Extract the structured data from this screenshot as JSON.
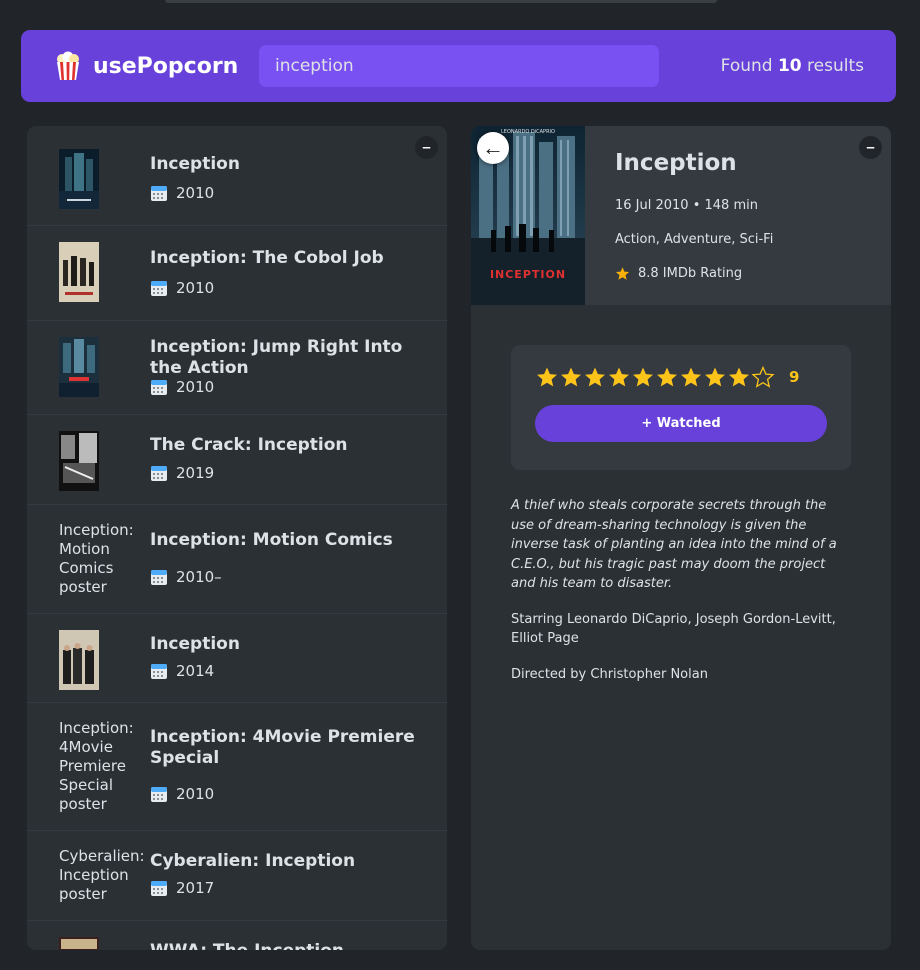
{
  "app": {
    "logo_text": "usePopcorn",
    "search_value": "inception",
    "results_prefix": "Found ",
    "results_count": "10",
    "results_suffix": " results"
  },
  "list_box": {
    "toggle_label": "–"
  },
  "movies": [
    {
      "title": "Inception",
      "year": "2010",
      "poster_alt": "",
      "has_poster": true
    },
    {
      "title": "Inception: The Cobol Job",
      "year": "2010",
      "poster_alt": "",
      "has_poster": true
    },
    {
      "title": "Inception: Jump Right Into the Action",
      "year": "2010",
      "poster_alt": "",
      "has_poster": true
    },
    {
      "title": "The Crack: Inception",
      "year": "2019",
      "poster_alt": "",
      "has_poster": true
    },
    {
      "title": "Inception: Motion Comics",
      "year": "2010–",
      "poster_alt": "Inception: Motion Comics poster",
      "has_poster": false
    },
    {
      "title": "Inception",
      "year": "2014",
      "poster_alt": "",
      "has_poster": true
    },
    {
      "title": "Inception: 4Movie Premiere Special",
      "year": "2010",
      "poster_alt": "Inception: 4Movie Premiere Special poster",
      "has_poster": false
    },
    {
      "title": "Cyberalien: Inception",
      "year": "2017",
      "poster_alt": "Cyberalien: Inception poster",
      "has_poster": false
    },
    {
      "title": "WWA: The Inception",
      "year": "",
      "poster_alt": "",
      "has_poster": true
    }
  ],
  "details": {
    "toggle_label": "–",
    "back_label": "←",
    "title": "Inception",
    "released_runtime": "16 Jul 2010 • 148 min",
    "genre": "Action, Adventure, Sci-Fi",
    "imdb": "8.8 IMDb Rating",
    "poster_title": "INCEPTION",
    "poster_top_text": "LEONARDO DiCAPRIO",
    "rating": {
      "max": 10,
      "value": 9,
      "label": "9"
    },
    "add_button": "+ Watched",
    "plot": "A thief who steals corporate secrets through the use of dream-sharing technology is given the inverse task of planting an idea into the mind of a C.E.O., but his tragic past may doom the project and his team to disaster.",
    "starring": "Starring Leonardo DiCaprio, Joseph Gordon-Levitt, Elliot Page",
    "directed": "Directed by Christopher Nolan"
  },
  "colors": {
    "background": "#212529",
    "nav": "#6741d9",
    "search": "#7950f2",
    "box": "#2b3035",
    "star": "#fcc419"
  }
}
